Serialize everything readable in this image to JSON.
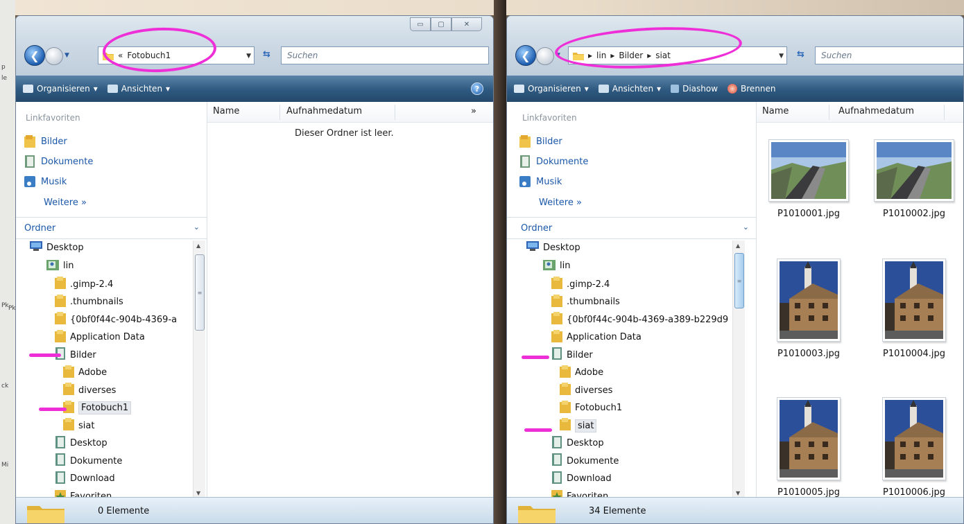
{
  "desktop": {
    "marks": [
      "p",
      "le",
      "Pk",
      "Pk",
      "ck",
      "Mi"
    ]
  },
  "left": {
    "controls": [
      "▭",
      "▢",
      "✕"
    ],
    "address": {
      "prefix": "«",
      "path": [
        "Fotobuch1"
      ]
    },
    "search_placeholder": "Suchen",
    "toolbar": {
      "organize": "Organisieren",
      "views": "Ansichten",
      "help": "?"
    },
    "favorites_header": "Linkfavoriten",
    "favorites": [
      "Bilder",
      "Dokumente",
      "Musik"
    ],
    "favorites_more": "Weitere  »",
    "folders_header": "Ordner",
    "tree": [
      {
        "label": "Desktop",
        "icon": "desktop-icon"
      },
      {
        "label": "lin",
        "icon": "user-folder-icon"
      },
      {
        "label": ".gimp-2.4",
        "icon": "folder-icon"
      },
      {
        "label": ".thumbnails",
        "icon": "folder-icon"
      },
      {
        "label": "{0bf0f44c-904b-4369-a",
        "icon": "folder-icon"
      },
      {
        "label": "Application Data",
        "icon": "folder-icon"
      },
      {
        "label": "Bilder",
        "icon": "library-folder-icon"
      },
      {
        "label": "Adobe",
        "icon": "folder-icon"
      },
      {
        "label": "diverses",
        "icon": "folder-icon"
      },
      {
        "label": "Fotobuch1",
        "icon": "folder-icon",
        "selected": true
      },
      {
        "label": "siat",
        "icon": "folder-icon"
      },
      {
        "label": "Desktop",
        "icon": "library-folder-icon"
      },
      {
        "label": "Dokumente",
        "icon": "library-folder-icon"
      },
      {
        "label": "Download",
        "icon": "library-folder-icon"
      },
      {
        "label": "Favoriten",
        "icon": "favorites-folder-icon"
      }
    ],
    "columns": {
      "name": "Name",
      "date": "Aufnahmedatum",
      "more": "»"
    },
    "empty_message": "Dieser Ordner ist leer.",
    "status": "0 Elemente"
  },
  "right": {
    "address": {
      "path": [
        "lin",
        "Bilder",
        "siat"
      ]
    },
    "search_placeholder": "Suchen",
    "toolbar": {
      "organize": "Organisieren",
      "views": "Ansichten",
      "slideshow": "Diashow",
      "burn": "Brennen"
    },
    "favorites_header": "Linkfavoriten",
    "favorites": [
      "Bilder",
      "Dokumente",
      "Musik"
    ],
    "favorites_more": "Weitere  »",
    "folders_header": "Ordner",
    "tree": [
      {
        "label": "Desktop",
        "icon": "desktop-icon"
      },
      {
        "label": "lin",
        "icon": "user-folder-icon"
      },
      {
        "label": ".gimp-2.4",
        "icon": "folder-icon"
      },
      {
        "label": ".thumbnails",
        "icon": "folder-icon"
      },
      {
        "label": "{0bf0f44c-904b-4369-a389-b229d9",
        "icon": "folder-icon"
      },
      {
        "label": "Application Data",
        "icon": "folder-icon"
      },
      {
        "label": "Bilder",
        "icon": "library-folder-icon"
      },
      {
        "label": "Adobe",
        "icon": "folder-icon"
      },
      {
        "label": "diverses",
        "icon": "folder-icon"
      },
      {
        "label": "Fotobuch1",
        "icon": "folder-icon"
      },
      {
        "label": "siat",
        "icon": "folder-icon",
        "selected": true
      },
      {
        "label": "Desktop",
        "icon": "library-folder-icon"
      },
      {
        "label": "Dokumente",
        "icon": "library-folder-icon"
      },
      {
        "label": "Download",
        "icon": "library-folder-icon"
      },
      {
        "label": "Favoriten",
        "icon": "favorites-folder-icon"
      }
    ],
    "columns": {
      "name": "Name",
      "date": "Aufnahmedatum"
    },
    "files": [
      {
        "name": "P1010001.jpg",
        "kind": "landscape"
      },
      {
        "name": "P1010002.jpg",
        "kind": "landscape"
      },
      {
        "name": "P1010003.jpg",
        "kind": "portrait"
      },
      {
        "name": "P1010004.jpg",
        "kind": "portrait"
      },
      {
        "name": "P1010005.jpg",
        "kind": "portrait"
      },
      {
        "name": "P1010006.jpg",
        "kind": "portrait"
      }
    ],
    "status": "34 Elemente"
  }
}
